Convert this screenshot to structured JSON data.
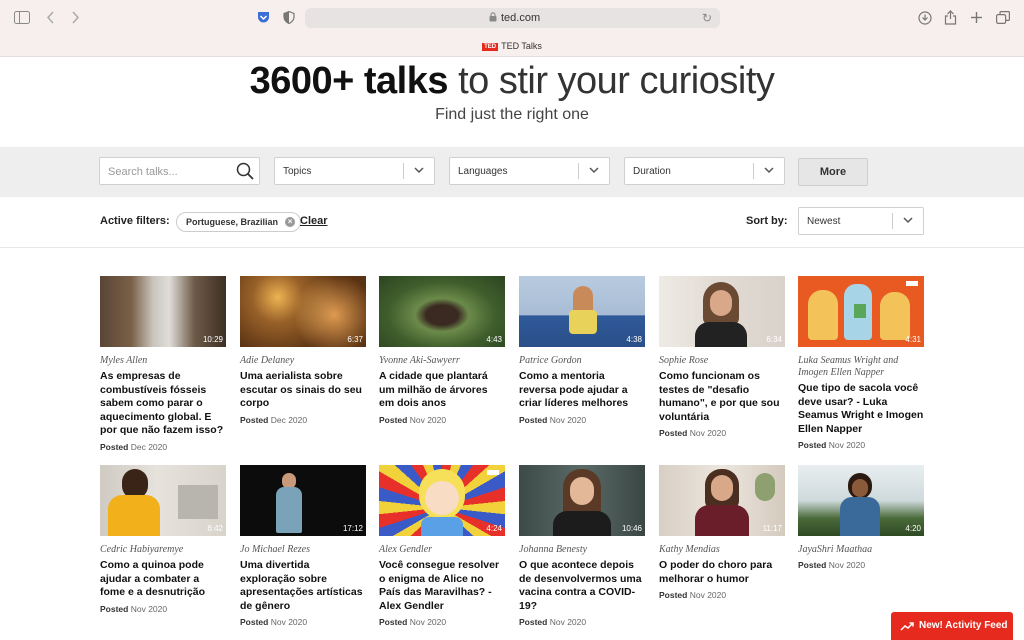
{
  "browser": {
    "url": "ted.com",
    "tab_title": "TED Talks",
    "tab_logo": "TED"
  },
  "hero": {
    "title_bold": "3600+ talks",
    "title_rest": "to stir your curiosity",
    "subtitle": "Find just the right one"
  },
  "filters": {
    "search_placeholder": "Search talks...",
    "topics": "Topics",
    "languages": "Languages",
    "duration": "Duration",
    "more": "More"
  },
  "active_filters": {
    "label": "Active filters:",
    "chip": "Portuguese, Brazilian",
    "clear": "Clear"
  },
  "sort": {
    "label": "Sort by:",
    "value": "Newest"
  },
  "talks": [
    {
      "speaker": "Myles Allen",
      "title": "As empresas de combustíveis fósseis sabem como parar o aquecimento global. E por que não fazem isso?",
      "posted_label": "Posted",
      "date": "Dec 2020",
      "duration": "10:29"
    },
    {
      "speaker": "Adie Delaney",
      "title": "Uma aerialista sobre escutar os sinais do seu corpo",
      "posted_label": "Posted",
      "date": "Dec 2020",
      "duration": "6:37"
    },
    {
      "speaker": "Yvonne Aki-Sawyerr",
      "title": "A cidade que plantará um milhão de árvores em dois anos",
      "posted_label": "Posted",
      "date": "Nov 2020",
      "duration": "4:43"
    },
    {
      "speaker": "Patrice Gordon",
      "title": "Como a mentoria reversa pode ajudar a criar líderes melhores",
      "posted_label": "Posted",
      "date": "Nov 2020",
      "duration": "4:38"
    },
    {
      "speaker": "Sophie Rose",
      "title": "Como funcionam os testes de \"desafio humano\", e por que sou voluntária",
      "posted_label": "Posted",
      "date": "Nov 2020",
      "duration": "6:34"
    },
    {
      "speaker": "Luka Seamus Wright and Imogen Ellen Napper",
      "title": "Que tipo de sacola você deve usar? - Luka Seamus Wright e Imogen Ellen Napper",
      "posted_label": "Posted",
      "date": "Nov 2020",
      "duration": "4:31"
    },
    {
      "speaker": "Cedric Habiyaremye",
      "title": "Como a quinoa pode ajudar a combater a fome e a desnutrição",
      "posted_label": "Posted",
      "date": "Nov 2020",
      "duration": "6:42"
    },
    {
      "speaker": "Jo Michael Rezes",
      "title": "Uma divertida exploração sobre apresentações artísticas de gênero",
      "posted_label": "Posted",
      "date": "Nov 2020",
      "duration": "17:12"
    },
    {
      "speaker": "Alex Gendler",
      "title": "Você consegue resolver o enigma de Alice no País das Maravilhas? - Alex Gendler",
      "posted_label": "Posted",
      "date": "Nov 2020",
      "duration": "4:24"
    },
    {
      "speaker": "Johanna Benesty",
      "title": "O que acontece depois de desenvolvermos uma vacina contra a COVID-19?",
      "posted_label": "Posted",
      "date": "Nov 2020",
      "duration": "10:46"
    },
    {
      "speaker": "Kathy Mendias",
      "title": "O poder do choro para melhorar o humor",
      "posted_label": "Posted",
      "date": "Nov 2020",
      "duration": "11:17"
    },
    {
      "speaker": "JayaShri Maathaa",
      "title": "",
      "posted_label": "Posted",
      "date": "Nov 2020",
      "duration": "4:20"
    }
  ],
  "activity_feed": "New! Activity Feed",
  "colors": {
    "ted_red": "#e62b1e",
    "chrome_bg": "#f7eeee",
    "band_bg": "#eeeeee"
  }
}
